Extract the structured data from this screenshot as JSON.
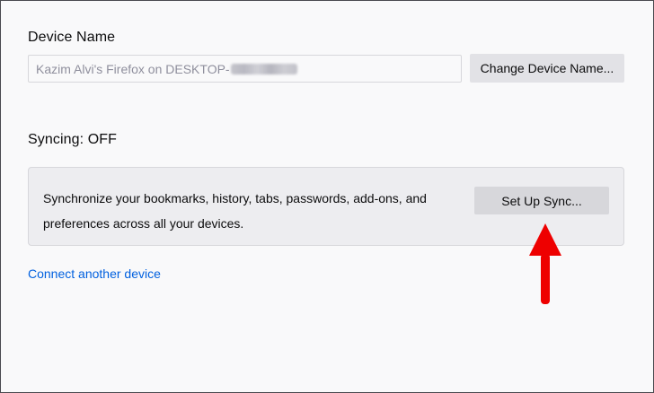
{
  "device": {
    "title": "Device Name",
    "input_value": "Kazim Alvi's Firefox on DESKTOP-",
    "redacted_suffix": "[redacted]",
    "change_button": "Change Device Name..."
  },
  "sync": {
    "title": "Syncing: OFF",
    "description": "Synchronize your bookmarks, history, tabs, passwords, add-ons, and preferences across all your devices.",
    "setup_button": "Set Up Sync..."
  },
  "connect_link": "Connect another device",
  "annotation": {
    "arrow_color": "#ee0000",
    "arrow_direction": "up"
  },
  "colors": {
    "link": "#0060df",
    "button_bg": "#e2e2e6",
    "box_bg": "#ededf0"
  }
}
